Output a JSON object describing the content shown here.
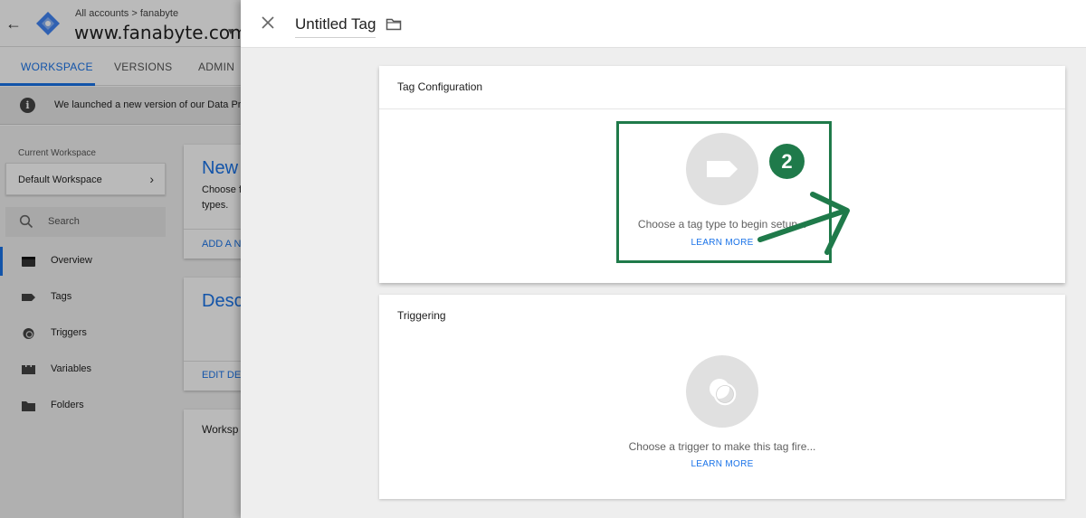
{
  "background": {
    "breadcrumb": {
      "all_accounts": "All accounts",
      "separator": ">",
      "account": "fanabyte"
    },
    "container_name": "www.fanabyte.com",
    "tabs": [
      {
        "label": "WORKSPACE",
        "active": true
      },
      {
        "label": "VERSIONS",
        "active": false
      },
      {
        "label": "ADMIN",
        "active": false
      }
    ],
    "banner": {
      "icon": "info-icon",
      "text": "We launched a new version of our Data Pro"
    },
    "sidebar": {
      "current_workspace_label": "Current Workspace",
      "workspace_name": "Default Workspace",
      "search_label": "Search",
      "items": [
        {
          "label": "Overview",
          "icon": "overview-icon",
          "active": true
        },
        {
          "label": "Tags",
          "icon": "tag-icon",
          "active": false
        },
        {
          "label": "Triggers",
          "icon": "trigger-icon",
          "active": false
        },
        {
          "label": "Variables",
          "icon": "variable-icon",
          "active": false
        },
        {
          "label": "Folders",
          "icon": "folder-icon",
          "active": false
        }
      ]
    },
    "cards": [
      {
        "title": "New",
        "text_lines": [
          "Choose f",
          "types."
        ],
        "link": "ADD A N"
      },
      {
        "title": "Desc",
        "link": "EDIT DES"
      },
      {
        "subtitle": "Worksp"
      }
    ]
  },
  "tag_editor": {
    "title": "Untitled Tag",
    "configuration": {
      "heading": "Tag Configuration",
      "prompt": "Choose a tag type to begin setup...",
      "learn_more": "LEARN MORE",
      "step_number": "2"
    },
    "triggering": {
      "heading": "Triggering",
      "prompt": "Choose a trigger to make this tag fire...",
      "learn_more": "LEARN MORE"
    }
  },
  "colors": {
    "accent": "#1a73e8",
    "annotation_green": "#1f7a4a",
    "icon_circle": "#e0e0e0"
  }
}
